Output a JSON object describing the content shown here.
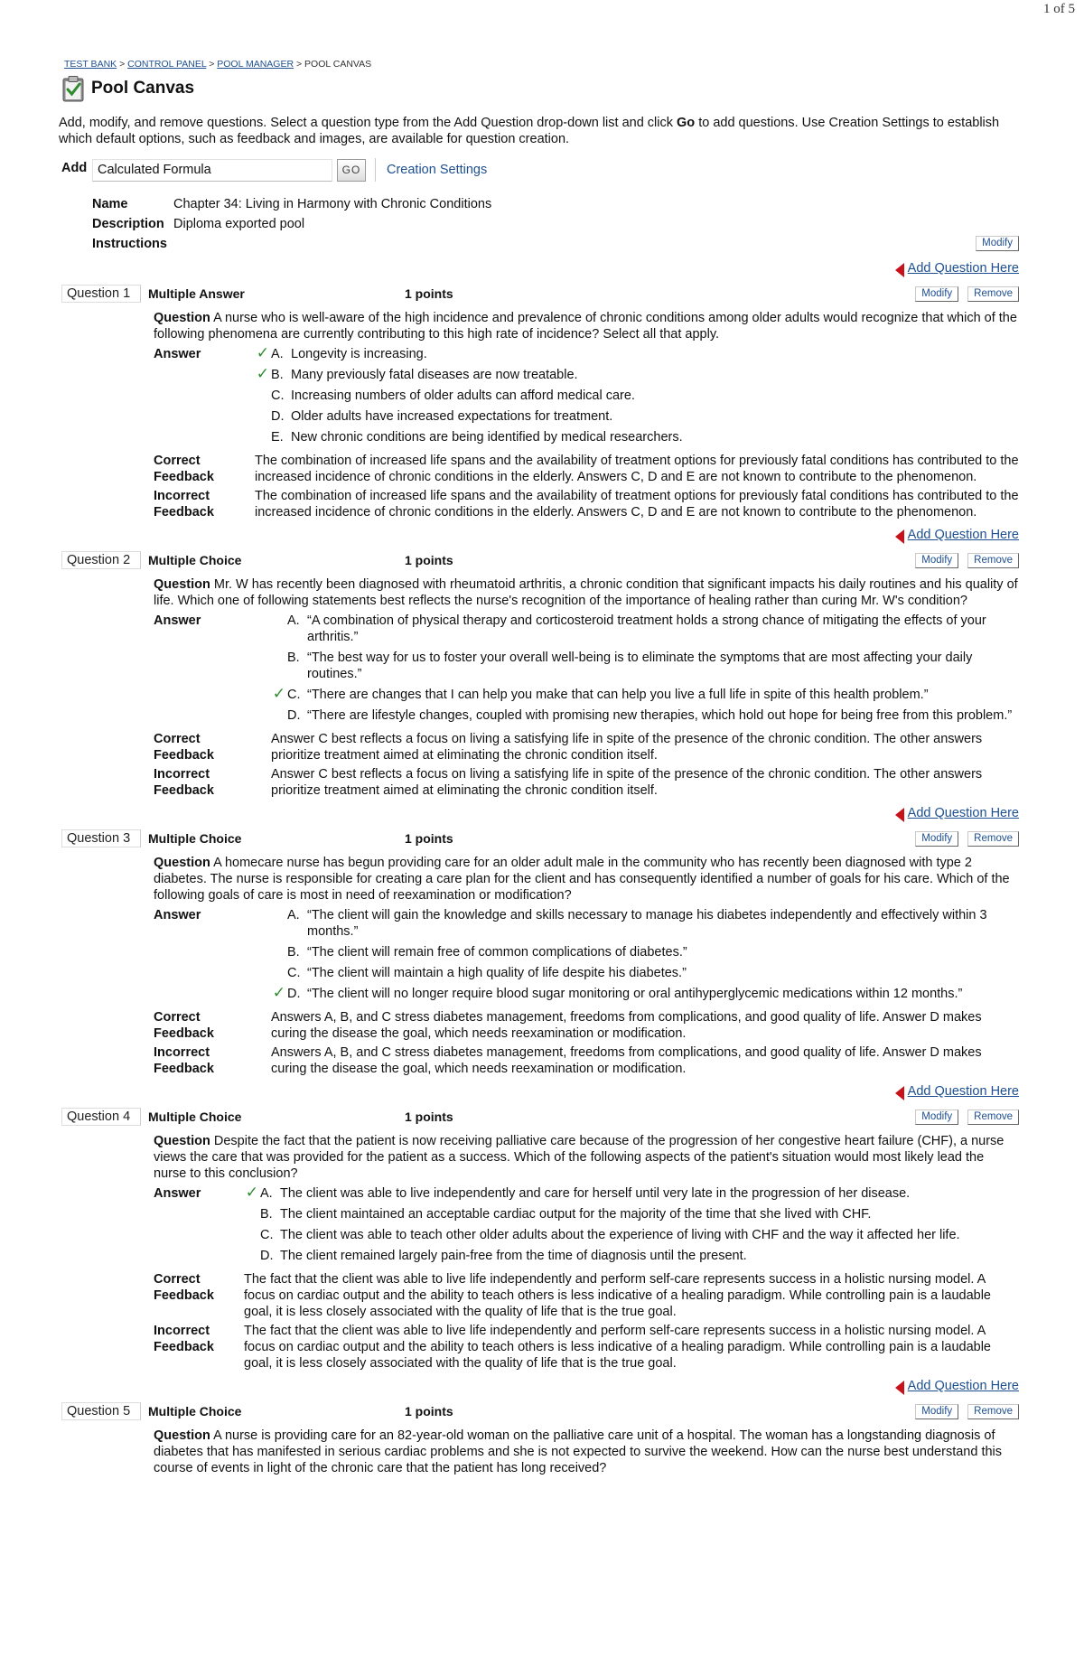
{
  "page_count": "1 of 5",
  "breadcrumb": {
    "test_bank": "TEST BANK",
    "control_panel": "CONTROL PANEL",
    "pool_manager": "POOL MANAGER",
    "current": "POOL CANVAS",
    "sep": ">"
  },
  "title": "Pool Canvas",
  "intro": {
    "part1": "Add, modify, and remove questions. Select a question type from the Add Question drop-down list and click ",
    "go_word": "Go",
    "part2": " to add questions. Use Creation Settings to establish which default options, such as feedback and images, are available for question creation."
  },
  "add_bar": {
    "label": "Add",
    "select_value": "Calculated Formula",
    "go_label": "GO",
    "creation_settings": "Creation Settings"
  },
  "meta": {
    "name_label": "Name",
    "name_value": "Chapter 34: Living in Harmony with Chronic Conditions",
    "description_label": "Description",
    "description_value": "Diploma exported pool",
    "instructions_label": "Instructions",
    "modify_label": "Modify"
  },
  "labels": {
    "add_question_here": "Add Question Here",
    "modify": "Modify",
    "remove": "Remove",
    "question": "Question",
    "answer": "Answer",
    "correct": "Correct",
    "incorrect": "Incorrect",
    "feedback": "Feedback",
    "check": "✓"
  },
  "questions": [
    {
      "num": "Question 1",
      "type": "Multiple Answer",
      "points": "1 points",
      "text": "A nurse who is well-aware of the high incidence and prevalence of chronic conditions among older adults would recognize that which of the following phenomena are currently contributing to this high rate of incidence? Select all that apply.",
      "answers": [
        {
          "letter": "A.",
          "text": "Longevity is increasing.",
          "correct": true
        },
        {
          "letter": "B.",
          "text": "Many previously fatal diseases are now treatable.",
          "correct": true
        },
        {
          "letter": "C.",
          "text": "Increasing numbers of older adults can afford medical care.",
          "correct": false
        },
        {
          "letter": "D.",
          "text": "Older adults have increased expectations for treatment.",
          "correct": false
        },
        {
          "letter": "E.",
          "text": "New chronic conditions are being identified by medical researchers.",
          "correct": false
        }
      ],
      "correct_feedback": "The combination of increased life spans and the availability of treatment options for previously fatal conditions has contributed to the increased incidence of chronic conditions in the elderly. Answers C, D and E are not known to contribute to the phenomenon.",
      "incorrect_feedback": "The combination of increased life spans and the availability of treatment options for previously fatal conditions has contributed to the increased incidence of chronic conditions in the elderly. Answers C, D and E are not known to contribute to the phenomenon."
    },
    {
      "num": "Question 2",
      "type": "Multiple Choice",
      "points": "1 points",
      "text": "Mr. W has recently been diagnosed with rheumatoid arthritis, a chronic condition that significant impacts his daily routines and his quality of life. Which one of following statements best reflects the nurse's recognition of the importance of healing rather than curing Mr. W's condition?",
      "answers": [
        {
          "letter": "A.",
          "text": "“A combination of physical therapy and corticosteroid treatment holds a strong chance of mitigating the effects of your arthritis.”",
          "correct": false
        },
        {
          "letter": "B.",
          "text": "“The best way for us to foster your overall well-being is to eliminate the symptoms that are most affecting your daily routines.”",
          "correct": false
        },
        {
          "letter": "C.",
          "text": "“There are changes that I can help you make that can help you live a full life in spite of this health problem.”",
          "correct": true
        },
        {
          "letter": "D.",
          "text": "“There are lifestyle changes, coupled with promising new therapies, which hold out hope for being free from this problem.”",
          "correct": false
        }
      ],
      "correct_feedback": "Answer C best reflects a focus on living a satisfying life in spite of the presence of the chronic condition. The other answers prioritize treatment aimed at eliminating the chronic condition itself.",
      "incorrect_feedback": "Answer C best reflects a focus on living a satisfying life in spite of the presence of the chronic condition. The other answers prioritize treatment aimed at eliminating the chronic condition itself."
    },
    {
      "num": "Question 3",
      "type": "Multiple Choice",
      "points": "1 points",
      "text": "A homecare nurse has begun providing care for an older adult male in the community who has recently been diagnosed with type 2 diabetes. The nurse is responsible for creating a care plan for the client and has consequently identified a number of goals for his care. Which of the following goals of care is most in need of reexamination or modification?",
      "answers": [
        {
          "letter": "A.",
          "text": "“The client will gain the knowledge and skills necessary to manage his diabetes independently and effectively within 3 months.”",
          "correct": false
        },
        {
          "letter": "B.",
          "text": "“The client will remain free of common complications of diabetes.”",
          "correct": false
        },
        {
          "letter": "C.",
          "text": "“The client will maintain a high quality of life despite his diabetes.”",
          "correct": false
        },
        {
          "letter": "D.",
          "text": "“The client will no longer require blood sugar monitoring or oral antihyperglycemic medications within 12 months.”",
          "correct": true
        }
      ],
      "correct_feedback": "Answers A, B, and C stress diabetes management, freedoms from complications, and good quality of life. Answer D makes curing the disease the goal, which needs reexamination or modification.",
      "incorrect_feedback": "Answers A, B, and C stress diabetes management, freedoms from complications, and good quality of life. Answer D makes curing the disease the goal, which needs reexamination or modification."
    },
    {
      "num": "Question 4",
      "type": "Multiple Choice",
      "points": "1 points",
      "text": "Despite the fact that the patient is now receiving palliative care because of the progression of her congestive heart failure (CHF), a nurse views the care that was provided for the patient as a success. Which of the following aspects of the patient's situation would most likely lead the nurse to this conclusion?",
      "answers": [
        {
          "letter": "A.",
          "text": "The client was able to live independently and care for herself until very late in the progression of her disease.",
          "correct": true
        },
        {
          "letter": "B.",
          "text": "The client maintained an acceptable cardiac output for the majority of the time that she lived with CHF.",
          "correct": false
        },
        {
          "letter": "C.",
          "text": "The client was able to teach other older adults about the experience of living with CHF and the way it affected her life.",
          "correct": false
        },
        {
          "letter": "D.",
          "text": "The client remained largely pain-free from the time of diagnosis until the present.",
          "correct": false
        }
      ],
      "correct_feedback": "The fact that the client was able to live life independently and perform self-care represents success in a holistic nursing model. A focus on cardiac output and the ability to teach others is less indicative of a healing paradigm. While controlling pain is a laudable goal, it is less closely associated with the quality of life that is the true goal.",
      "incorrect_feedback": "The fact that the client was able to live life independently and perform self-care represents success in a holistic nursing model. A focus on cardiac output and the ability to teach others is less indicative of a healing paradigm. While controlling pain is a laudable goal, it is less closely associated with the quality of life that is the true goal."
    },
    {
      "num": "Question 5",
      "type": "Multiple Choice",
      "points": "1 points",
      "text": "A nurse is providing care for an 82-year-old woman on the palliative care unit of a hospital. The woman has a longstanding diagnosis of diabetes that has manifested in serious cardiac problems and she is not expected to survive the weekend. How can the nurse best understand this course of events in light of the chronic care that the patient has long received?",
      "answers": []
    }
  ]
}
